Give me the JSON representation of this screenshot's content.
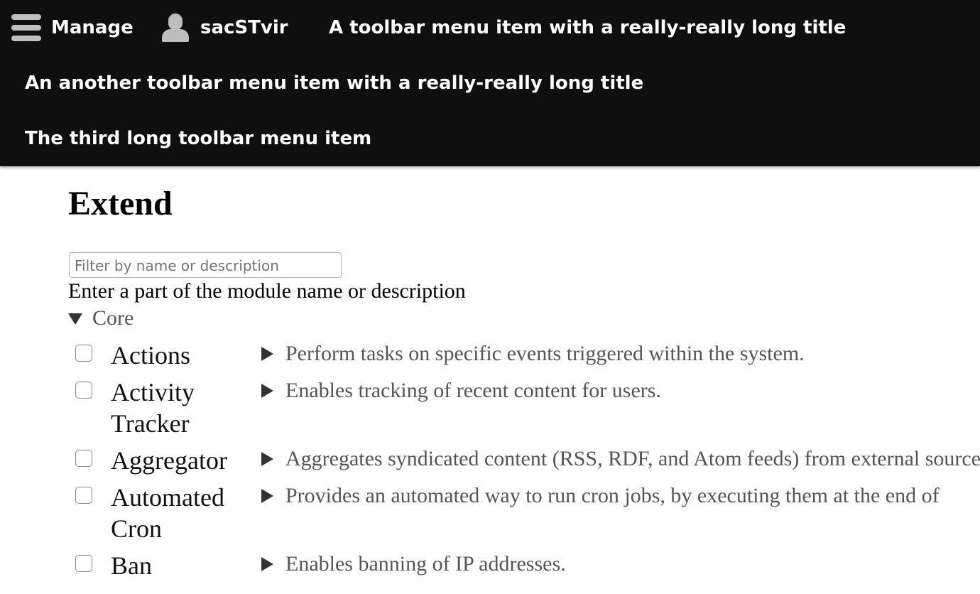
{
  "toolbar": {
    "manage_label": "Manage",
    "user_label": "sacSTvir",
    "items": [
      "A toolbar menu item with a really-really long title",
      "An another toolbar menu item with a really-really long title",
      "The third long toolbar menu item"
    ]
  },
  "page": {
    "title": "Extend"
  },
  "filter": {
    "placeholder": "Filter by name or description",
    "help": "Enter a part of the module name or description"
  },
  "group": {
    "label": "Core"
  },
  "modules": [
    {
      "name": "Actions",
      "description": "Perform tasks on specific events triggered within the system."
    },
    {
      "name": "Activity Tracker",
      "description": "Enables tracking of recent content for users."
    },
    {
      "name": "Aggregator",
      "description": "Aggregates syndicated content (RSS, RDF, and Atom feeds) from external sources."
    },
    {
      "name": "Automated Cron",
      "description": "Provides an automated way to run cron jobs, by executing them at the end of"
    },
    {
      "name": "Ban",
      "description": "Enables banning of IP addresses."
    }
  ]
}
